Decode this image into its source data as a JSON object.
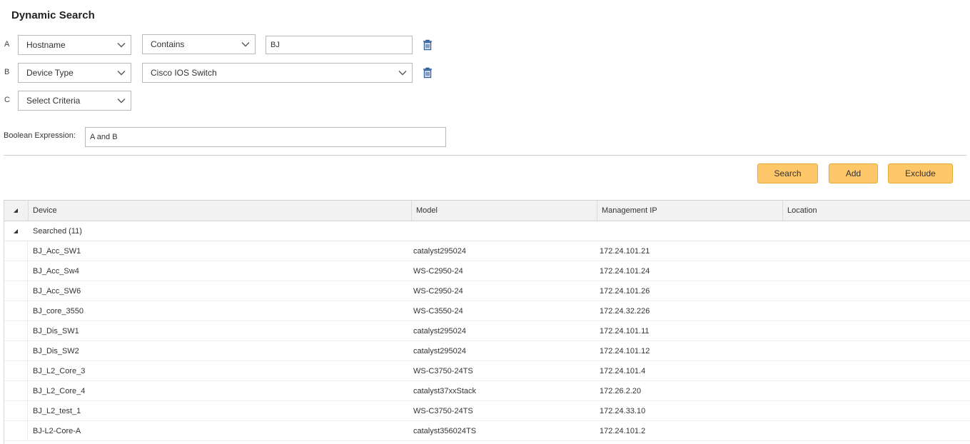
{
  "page": {
    "title": "Dynamic Search"
  },
  "criteria": [
    {
      "letter": "A",
      "field": "Hostname",
      "operator": "Contains",
      "value": "BJ"
    },
    {
      "letter": "B",
      "field": "Device Type",
      "value_select": "Cisco IOS Switch"
    },
    {
      "letter": "C",
      "field": "Select Criteria"
    }
  ],
  "boolean": {
    "label": "Boolean Expression:",
    "value": "A and B"
  },
  "buttons": {
    "search": "Search",
    "add": "Add",
    "exclude": "Exclude"
  },
  "colors": {
    "button_bg": "#fdc76a",
    "icon_blue": "#2f5f9e"
  },
  "table": {
    "columns": [
      "Device",
      "Model",
      "Management IP",
      "Location"
    ],
    "group_label": "Searched (11)",
    "rows": [
      {
        "device": "BJ_Acc_SW1",
        "model": "catalyst295024",
        "ip": "172.24.101.21",
        "location": ""
      },
      {
        "device": "BJ_Acc_Sw4",
        "model": "WS-C2950-24",
        "ip": "172.24.101.24",
        "location": ""
      },
      {
        "device": "BJ_Acc_SW6",
        "model": "WS-C2950-24",
        "ip": "172.24.101.26",
        "location": ""
      },
      {
        "device": "BJ_core_3550",
        "model": "WS-C3550-24",
        "ip": "172.24.32.226",
        "location": ""
      },
      {
        "device": "BJ_Dis_SW1",
        "model": "catalyst295024",
        "ip": "172.24.101.11",
        "location": ""
      },
      {
        "device": "BJ_Dis_SW2",
        "model": "catalyst295024",
        "ip": "172.24.101.12",
        "location": ""
      },
      {
        "device": "BJ_L2_Core_3",
        "model": "WS-C3750-24TS",
        "ip": "172.24.101.4",
        "location": ""
      },
      {
        "device": "BJ_L2_Core_4",
        "model": "catalyst37xxStack",
        "ip": "172.26.2.20",
        "location": ""
      },
      {
        "device": "BJ_L2_test_1",
        "model": "WS-C3750-24TS",
        "ip": "172.24.33.10",
        "location": ""
      },
      {
        "device": "BJ-L2-Core-A",
        "model": "catalyst356024TS",
        "ip": "172.24.101.2",
        "location": ""
      }
    ]
  }
}
